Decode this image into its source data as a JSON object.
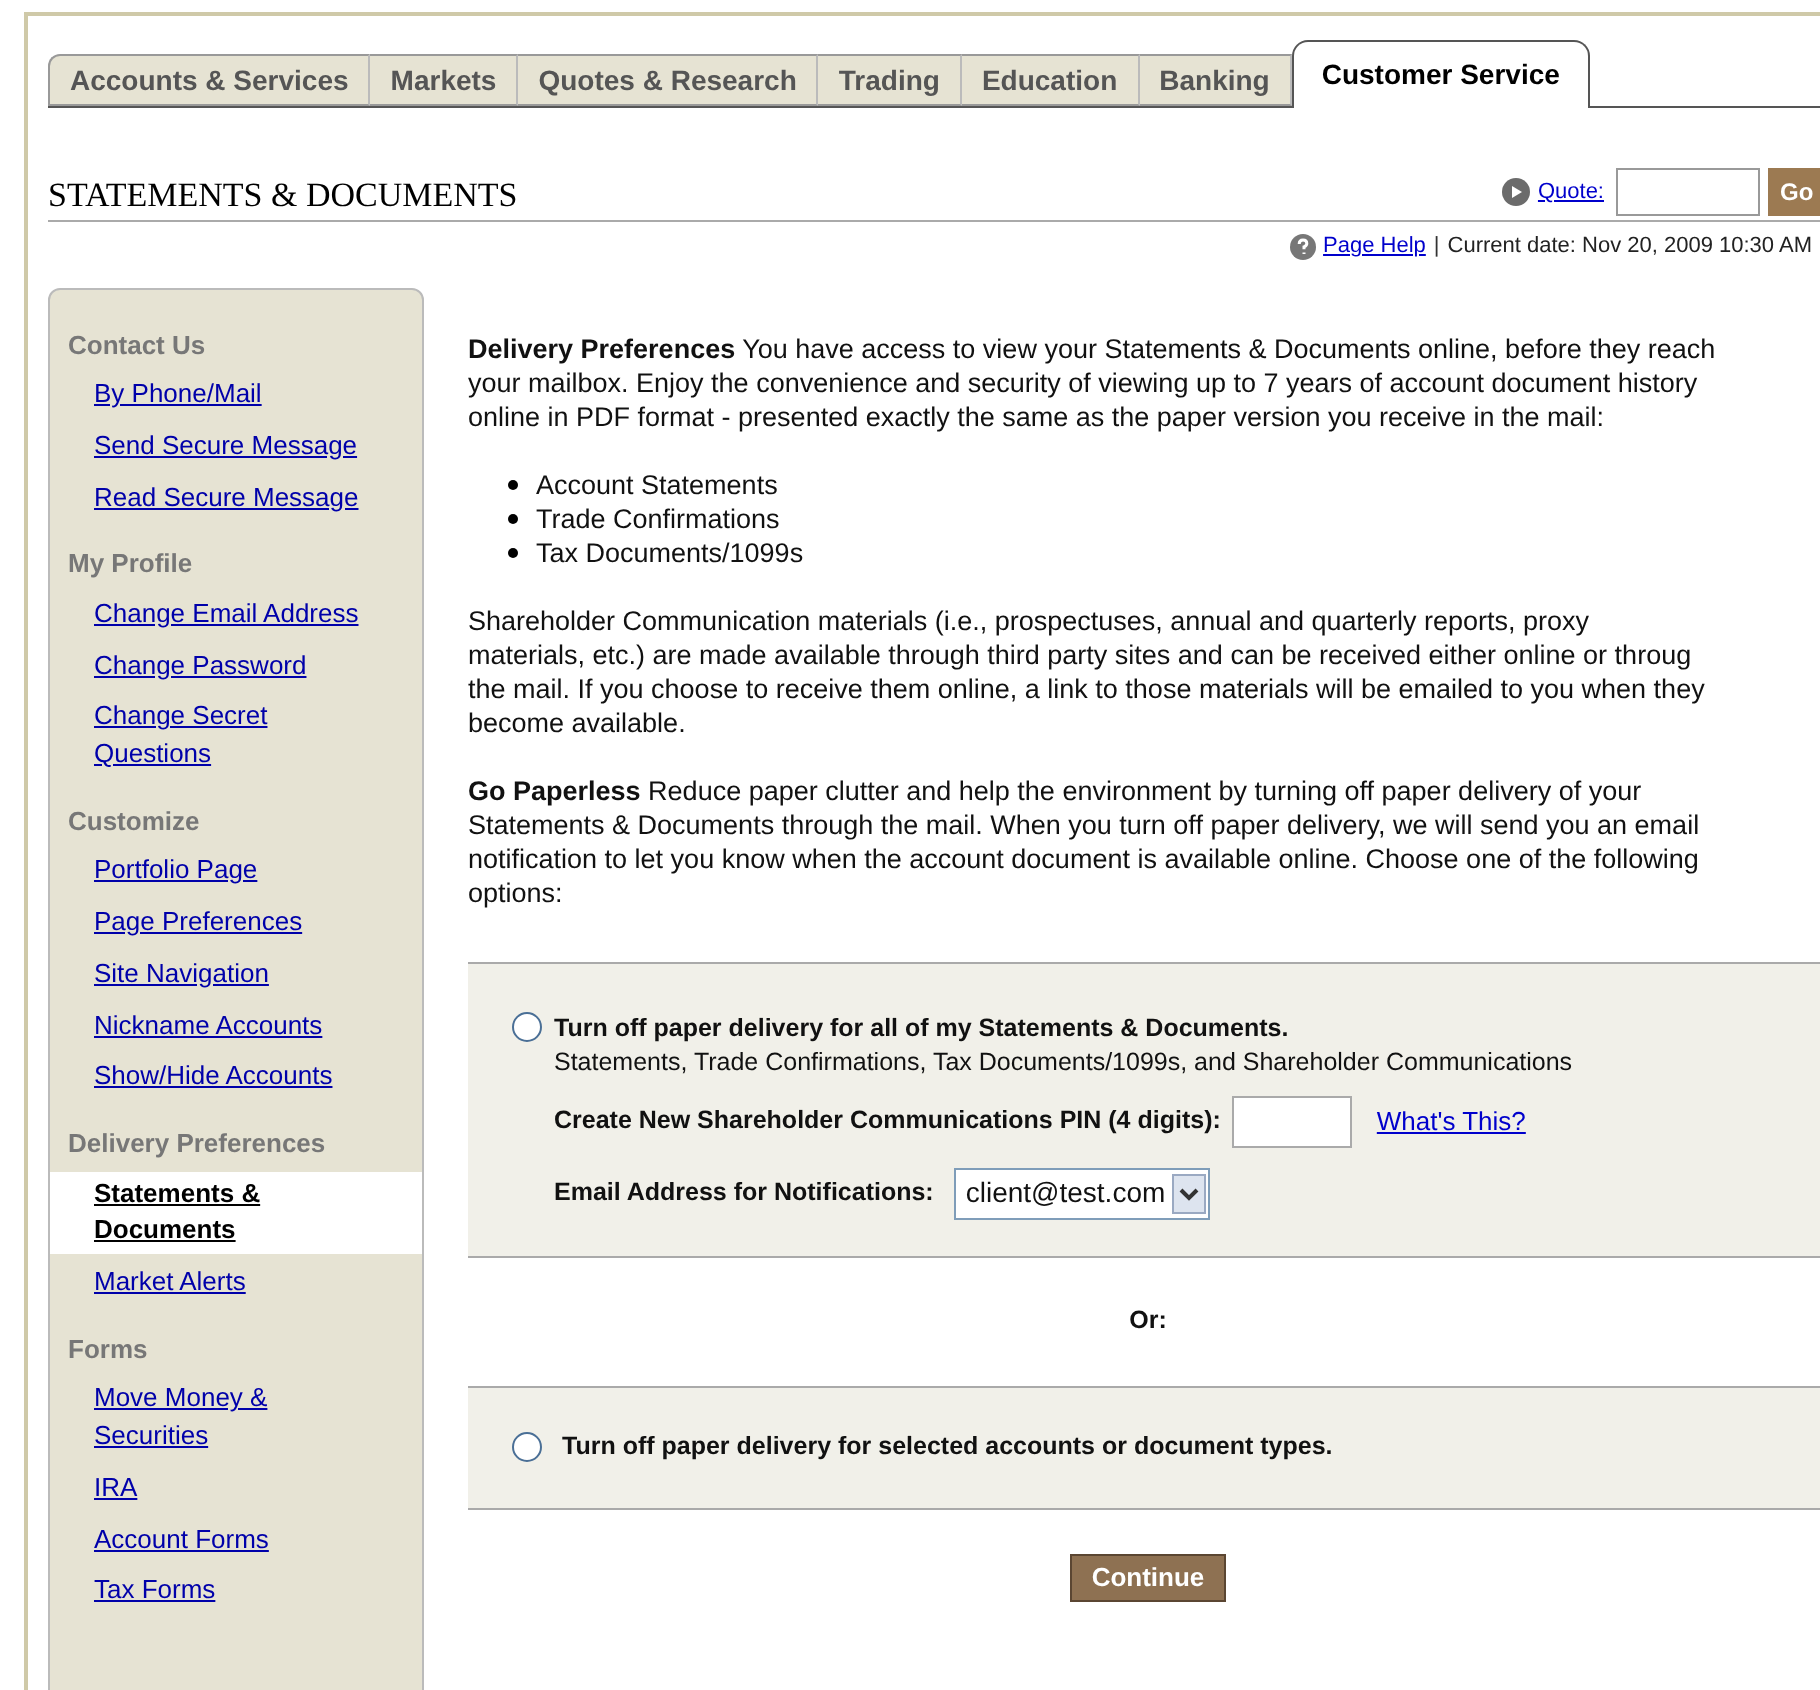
{
  "tabs": [
    {
      "label": "Accounts & Services",
      "selected": false
    },
    {
      "label": "Markets",
      "selected": false
    },
    {
      "label": "Quotes & Research",
      "selected": false
    },
    {
      "label": "Trading",
      "selected": false
    },
    {
      "label": "Education",
      "selected": false
    },
    {
      "label": "Banking",
      "selected": false
    },
    {
      "label": "Customer Service",
      "selected": true
    }
  ],
  "page_title": "STATEMENTS & DOCUMENTS",
  "quote": {
    "label": "Quote:",
    "button": "Go"
  },
  "help": {
    "link": "Page Help",
    "separator": "|",
    "date": "Current date: Nov 20, 2009 10:30 AM"
  },
  "sidebar": [
    {
      "heading": "Contact Us",
      "items": [
        {
          "label": "By Phone/Mail",
          "selected": false
        },
        {
          "label": "Send Secure Message",
          "selected": false
        },
        {
          "label": "Read Secure Message",
          "selected": false
        }
      ]
    },
    {
      "heading": "My Profile",
      "items": [
        {
          "label": "Change Email Address",
          "selected": false
        },
        {
          "label": "Change Password",
          "selected": false
        },
        {
          "label": "Change Secret Questions",
          "selected": false
        }
      ]
    },
    {
      "heading": "Customize",
      "items": [
        {
          "label": "Portfolio Page",
          "selected": false
        },
        {
          "label": "Page Preferences",
          "selected": false
        },
        {
          "label": "Site Navigation",
          "selected": false
        },
        {
          "label": "Nickname Accounts",
          "selected": false
        },
        {
          "label": "Show/Hide Accounts",
          "selected": false
        }
      ]
    },
    {
      "heading": "Delivery Preferences",
      "items": [
        {
          "label": "Statements & Documents",
          "selected": true
        },
        {
          "label": "Market Alerts",
          "selected": false
        }
      ]
    },
    {
      "heading": "Forms",
      "items": [
        {
          "label": "Move Money & Securities",
          "selected": false
        },
        {
          "label": "IRA",
          "selected": false
        },
        {
          "label": "Account Forms",
          "selected": false
        },
        {
          "label": "Tax Forms",
          "selected": false
        }
      ]
    }
  ],
  "intro_lines": [
    "**Delivery Preferences** You have access to view your Statements & Documents online, before they reach",
    "your mailbox. Enjoy the convenience and security of viewing up to 7 years of account document history",
    "online in PDF format - presented exactly the same as the paper version you receive in the mail:"
  ],
  "bullets": [
    "Account Statements",
    "Trade Confirmations",
    "Tax Documents/1099s"
  ],
  "shareholder_lines": [
    "Shareholder Communication materials (i.e., prospectuses, annual and quarterly reports, proxy",
    "materials, etc.) are made available through third party sites and can be received either online or throug",
    "the mail. If you choose to receive them online, a link to those materials will be emailed to you when they",
    "become available."
  ],
  "paperless_lines": [
    "**Go Paperless** Reduce paper clutter and help the environment by turning off paper delivery of your",
    "Statements & Documents through the mail. When you turn off paper delivery, we will send you an email",
    "notification to let you know when the account document is available online. Choose one of the following",
    "options:"
  ],
  "option_all": {
    "label": "Turn off paper delivery for all of my Statements & Documents.",
    "selected": false,
    "detail": "Statements, Trade Confirmations, Tax Documents/1099s, and Shareholder Communications",
    "pin_label": "Create New Shareholder Communications PIN (4 digits):",
    "pin_link": "What's This?",
    "email_label": "Email Address for Notifications:",
    "email_value": "client@test.com"
  },
  "or_label": "Or:",
  "option_selected": {
    "label": "Turn off paper delivery for selected accounts or document types.",
    "selected": false
  },
  "continue_button": "Continue"
}
